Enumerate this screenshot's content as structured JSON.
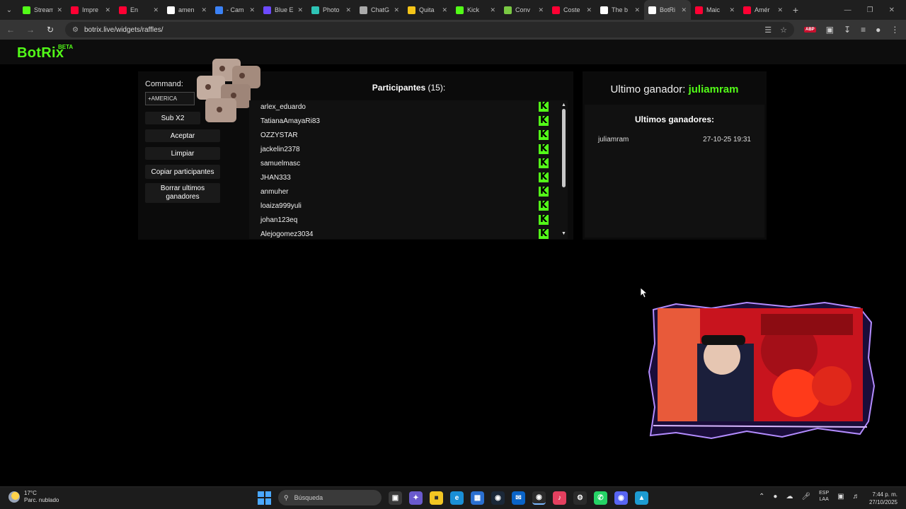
{
  "browser": {
    "tabs": [
      {
        "label": "Stream",
        "color": "#53fc18"
      },
      {
        "label": "Impre",
        "color": "#ff0033"
      },
      {
        "label": "En",
        "color": "#ff0033"
      },
      {
        "label": "amen",
        "color": "#ffffff"
      },
      {
        "label": "- Cam",
        "color": "#3b82f6"
      },
      {
        "label": "Blue E",
        "color": "#6d4aff"
      },
      {
        "label": "Photo",
        "color": "#2ec4b6"
      },
      {
        "label": "ChatG",
        "color": "#aaaaaa"
      },
      {
        "label": "Quita",
        "color": "#f5c518"
      },
      {
        "label": "Kick",
        "color": "#53fc18"
      },
      {
        "label": "Conv",
        "color": "#7ac943"
      },
      {
        "label": "Coste",
        "color": "#ff0033"
      },
      {
        "label": "The b",
        "color": "#ffffff"
      },
      {
        "label": "BotRi",
        "color": "#ffffff"
      },
      {
        "label": "Maic",
        "color": "#ff0033"
      },
      {
        "label": "Amér",
        "color": "#ff0033"
      }
    ],
    "active_tab_index": 13,
    "url": "botrix.live/widgets/raffles/"
  },
  "app": {
    "logo": "BotRix",
    "logo_badge": "BETA",
    "accent": "#53fc18"
  },
  "controls": {
    "command_label": "Command:",
    "command_value": "+AMERICA",
    "buttons": {
      "sub": "Sub X2",
      "accept": "Aceptar",
      "clear": "Limpiar",
      "copy": "Copiar participantes",
      "delete": "Borrar ultimos ganadores"
    }
  },
  "participants": {
    "title": "Participantes",
    "count": "(15):",
    "visible": [
      "arlex_eduardo",
      "TatianaAmayaRi83",
      "OZZYSTAR",
      "jackelin2378",
      "samuelmasc",
      "JHAN333",
      "anmuher",
      "loaiza999yuli",
      "johan123eq",
      "Alejogomez3034"
    ],
    "platform_icon": "K"
  },
  "winners": {
    "last_label": "Ultimo ganador:",
    "last_name": "juliamram",
    "list_title": "Ultimos ganadores:",
    "list": [
      {
        "name": "juliamram",
        "date": "27-10-25 19:31"
      }
    ]
  },
  "taskbar": {
    "weather_temp": "17°C",
    "weather_desc": "Parc. nublado",
    "search_placeholder": "Búsqueda",
    "lang_line1": "ESP",
    "lang_line2": "LAA",
    "time": "7:44 p. m.",
    "date": "27/10/2025"
  }
}
